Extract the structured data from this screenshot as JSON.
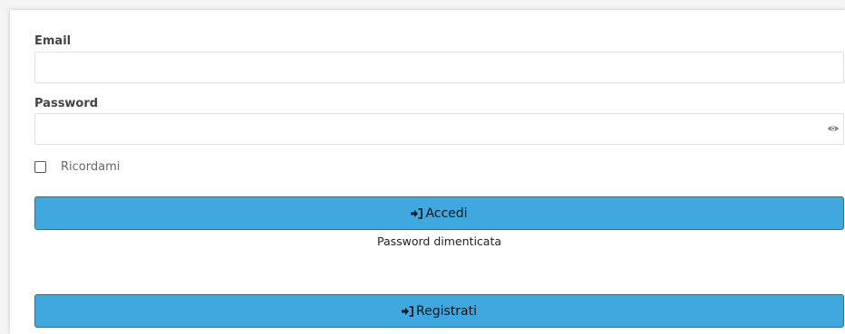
{
  "form": {
    "email_label": "Email",
    "email_value": "",
    "password_label": "Password",
    "password_value": "",
    "remember_label": "Ricordami",
    "remember_checked": false,
    "login_label": "Accedi",
    "forgot_label": "Password dimenticata",
    "register_label": "Registrati"
  },
  "icons": {
    "password_toggle": "eye-icon",
    "login": "sign-in-icon",
    "register": "sign-in-icon"
  },
  "colors": {
    "button_bg": "#3ea8df",
    "button_border": "#2b6f93"
  }
}
